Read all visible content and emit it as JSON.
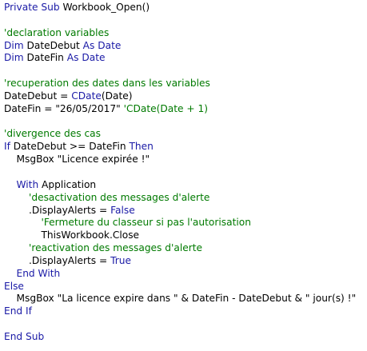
{
  "editor": {
    "colors": {
      "keyword": "#1a1aa6",
      "comment": "#007a00",
      "text": "#000000",
      "background": "#ffffff"
    },
    "lines": [
      [
        {
          "t": "kw",
          "v": "Private Sub "
        },
        {
          "t": "tx",
          "v": "Workbook_Open()"
        }
      ],
      [],
      [
        {
          "t": "cm",
          "v": "'declaration variables"
        }
      ],
      [
        {
          "t": "kw",
          "v": "Dim "
        },
        {
          "t": "tx",
          "v": "DateDebut "
        },
        {
          "t": "kw",
          "v": "As Date"
        }
      ],
      [
        {
          "t": "kw",
          "v": "Dim "
        },
        {
          "t": "tx",
          "v": "DateFin "
        },
        {
          "t": "kw",
          "v": "As Date"
        }
      ],
      [],
      [
        {
          "t": "cm",
          "v": "'recuperation des dates dans les variables"
        }
      ],
      [
        {
          "t": "tx",
          "v": "DateDebut = "
        },
        {
          "t": "kw",
          "v": "CDate"
        },
        {
          "t": "tx",
          "v": "(Date)"
        }
      ],
      [
        {
          "t": "tx",
          "v": "DateFin = \"26/05/2017\" "
        },
        {
          "t": "cm",
          "v": "'CDate(Date + 1)"
        }
      ],
      [],
      [
        {
          "t": "cm",
          "v": "'divergence des cas"
        }
      ],
      [
        {
          "t": "kw",
          "v": "If "
        },
        {
          "t": "tx",
          "v": "DateDebut >= DateFin "
        },
        {
          "t": "kw",
          "v": "Then"
        }
      ],
      [
        {
          "t": "tx",
          "v": "    MsgBox \"Licence expirée !\""
        }
      ],
      [],
      [
        {
          "t": "kw",
          "v": "    With "
        },
        {
          "t": "tx",
          "v": "Application"
        }
      ],
      [
        {
          "t": "cm",
          "v": "        'desactivation des messages d'alerte"
        }
      ],
      [
        {
          "t": "tx",
          "v": "        .DisplayAlerts = "
        },
        {
          "t": "kw",
          "v": "False"
        }
      ],
      [
        {
          "t": "cm",
          "v": "            'Fermeture du classeur si pas l'autorisation"
        }
      ],
      [
        {
          "t": "tx",
          "v": "            ThisWorkbook.Close"
        }
      ],
      [
        {
          "t": "cm",
          "v": "        'reactivation des messages d'alerte"
        }
      ],
      [
        {
          "t": "tx",
          "v": "        .DisplayAlerts = "
        },
        {
          "t": "kw",
          "v": "True"
        }
      ],
      [
        {
          "t": "kw",
          "v": "    End With"
        }
      ],
      [
        {
          "t": "kw",
          "v": "Else"
        }
      ],
      [
        {
          "t": "tx",
          "v": "    MsgBox \"La licence expire dans \" & DateFin - DateDebut & \" jour(s) !\""
        }
      ],
      [
        {
          "t": "kw",
          "v": "End If"
        }
      ],
      [],
      [
        {
          "t": "kw",
          "v": "End Sub"
        }
      ]
    ]
  }
}
